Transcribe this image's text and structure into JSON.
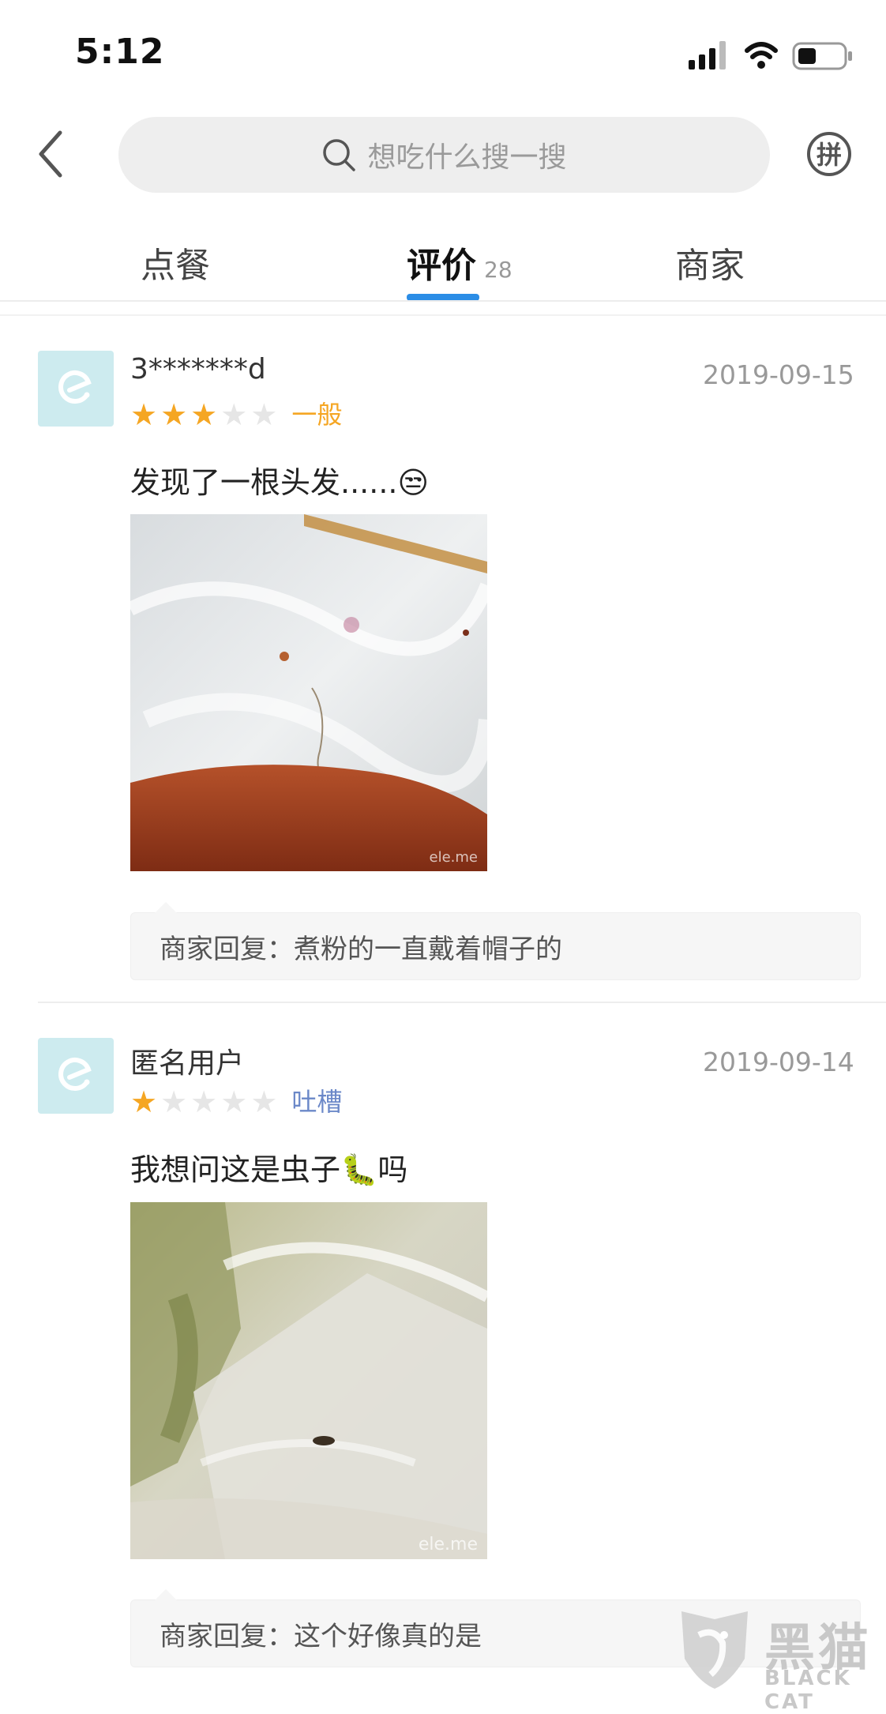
{
  "status_bar": {
    "time": "5:12"
  },
  "search": {
    "placeholder": "想吃什么搜一搜"
  },
  "tabs": [
    {
      "label": "点餐"
    },
    {
      "label": "评价",
      "count": "28",
      "active": true
    },
    {
      "label": "商家"
    }
  ],
  "reviews": [
    {
      "username": "3*******d",
      "date": "2019-09-15",
      "stars": 3,
      "rating_word": "一般",
      "rating_color": "#f5a623",
      "text": "发现了一根头发......",
      "emoji": "😒",
      "photo_watermark": "ele.me",
      "reply": "商家回复：煮粉的一直戴着帽子的"
    },
    {
      "username": "匿名用户",
      "date": "2019-09-14",
      "stars": 1,
      "rating_word": "吐槽",
      "rating_color": "#6b88c8",
      "text_before": "我想问这是虫子",
      "emoji": "🐛",
      "text_after": "吗",
      "photo_watermark": "ele.me",
      "reply": "商家回复：这个好像真的是"
    }
  ],
  "watermark": {
    "title": "黑猫",
    "subtitle": "BLACK CAT"
  }
}
